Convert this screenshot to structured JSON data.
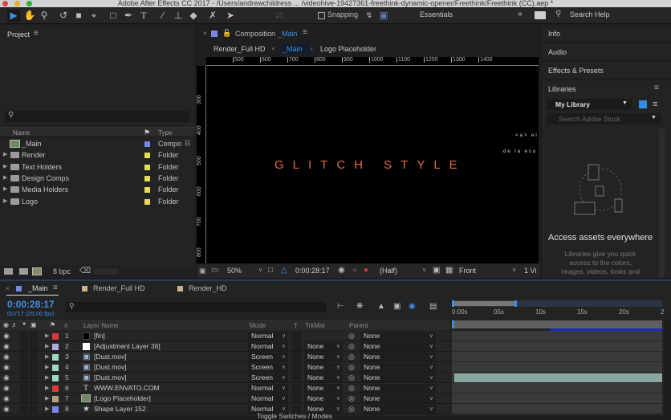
{
  "window": {
    "title": "Adobe After Effects CC 2017 - /Users/andrewchildress ... /videohive-19427361-freethink-dynamic-opener/Freethink/Freethink (CC).aep *"
  },
  "toolbar": {
    "tools": [
      "selection-tool",
      "hand-tool",
      "zoom-tool",
      "rotation-tool",
      "camera-tool",
      "pan-behind-tool",
      "rectangle-tool",
      "pen-tool",
      "type-tool",
      "brush-tool",
      "clone-stamp-tool",
      "eraser-tool",
      "roto-brush-tool",
      "puppet-pin-tool"
    ],
    "snapping_label": "Snapping",
    "workspace_label": "Essentials",
    "more_label": "»",
    "search_placeholder": "Search Help"
  },
  "project": {
    "title": "Project",
    "search_placeholder": "",
    "col_name": "Name",
    "col_type": "Type",
    "items": [
      {
        "name": "_Main",
        "type": "Compo",
        "color": "#7a86e8",
        "kind": "composition"
      },
      {
        "name": "Render",
        "type": "Folder",
        "color": "#e6dc5a",
        "kind": "folder"
      },
      {
        "name": "Text Holders",
        "type": "Folder",
        "color": "#e6dc5a",
        "kind": "folder"
      },
      {
        "name": "Design Comps",
        "type": "Folder",
        "color": "#e6dc5a",
        "kind": "folder"
      },
      {
        "name": "Media Holders",
        "type": "Folder",
        "color": "#e6dc5a",
        "kind": "folder"
      },
      {
        "name": "Logo",
        "type": "Folder",
        "color": "#e6dc5a",
        "kind": "folder"
      }
    ],
    "bpc_label": "8 bpc"
  },
  "composition": {
    "tab_prefix": "Composition",
    "tab_name": "_Main",
    "breadcrumbs": [
      "Render_Full HD",
      "_Main",
      "Logo Placeholder"
    ],
    "ruler_h": [
      "500",
      "600",
      "700",
      "800",
      "900",
      "1000",
      "1100",
      "1200",
      "1300",
      "1400"
    ],
    "ruler_v": [
      "300",
      "400",
      "500",
      "600",
      "700",
      "800"
    ],
    "canvas_title": "GLITCH STYLE",
    "canvas_side_1": "<a> el",
    "canvas_side_2": "de la ecu",
    "footer": {
      "zoom": "50%",
      "timecode": "0:00:28:17",
      "resolution": "(Half)",
      "view": "Front",
      "views_count": "1 Vi"
    }
  },
  "right_panels": {
    "info": "Info",
    "audio": "Audio",
    "effects": "Effects & Presets",
    "libraries": "Libraries",
    "library_select": "My Library",
    "stock_placeholder": "Search Adobe Stock",
    "promo_title": "Access assets everywhere",
    "promo_body": [
      "Libraries give you quick",
      "access to the colors,",
      "images, videos, looks and"
    ]
  },
  "timeline": {
    "tabs": [
      {
        "name": "_Main",
        "color": "#7a86e8",
        "active": true
      },
      {
        "name": "Render_Full HD",
        "color": "#c8b48a",
        "active": false
      },
      {
        "name": "Render_HD",
        "color": "#c8b48a",
        "active": false
      }
    ],
    "timecode": "0:00:28:17",
    "frame_info": "00717 (25.00 fps)",
    "cols": {
      "layer_name": "Layer Name",
      "mode": "Mode",
      "t": "T",
      "trkmat": "TrkMat",
      "parent": "Parent"
    },
    "time_ticks": [
      "0:00s",
      "05s",
      "10s",
      "15s",
      "20s",
      "2"
    ],
    "layers": [
      {
        "num": "1",
        "name": "[fin]",
        "color": "#d83a3a",
        "icon": "solid-black",
        "mode": "Normal",
        "trkmat": "",
        "parent": "None"
      },
      {
        "num": "2",
        "name": "[Adjustment Layer 36]",
        "color": "#b7a8de",
        "icon": "solid-white",
        "mode": "Normal",
        "trkmat": "None",
        "parent": "None"
      },
      {
        "num": "3",
        "name": "[Dust.mov]",
        "color": "#9fd4c8",
        "icon": "footage",
        "mode": "Screen",
        "trkmat": "None",
        "parent": "None"
      },
      {
        "num": "4",
        "name": "[Dust.mov]",
        "color": "#9fd4c8",
        "icon": "footage",
        "mode": "Screen",
        "trkmat": "None",
        "parent": "None"
      },
      {
        "num": "5",
        "name": "[Dust.mov]",
        "color": "#9fd4c8",
        "icon": "footage",
        "mode": "Screen",
        "trkmat": "None",
        "parent": "None"
      },
      {
        "num": "6",
        "name": "WWW.ENVATO.COM",
        "color": "#d83a3a",
        "icon": "text",
        "mode": "Normal",
        "trkmat": "None",
        "parent": "None"
      },
      {
        "num": "7",
        "name": "[Logo Placeholder]",
        "color": "#b5a07e",
        "icon": "composition",
        "mode": "Normal",
        "trkmat": "None",
        "parent": "None"
      },
      {
        "num": "8",
        "name": "Shape Layer 152",
        "color": "#7a86e8",
        "icon": "shape",
        "mode": "Normal",
        "trkmat": "None",
        "parent": "None"
      }
    ],
    "toggle_label": "Toggle Switches / Modes"
  }
}
